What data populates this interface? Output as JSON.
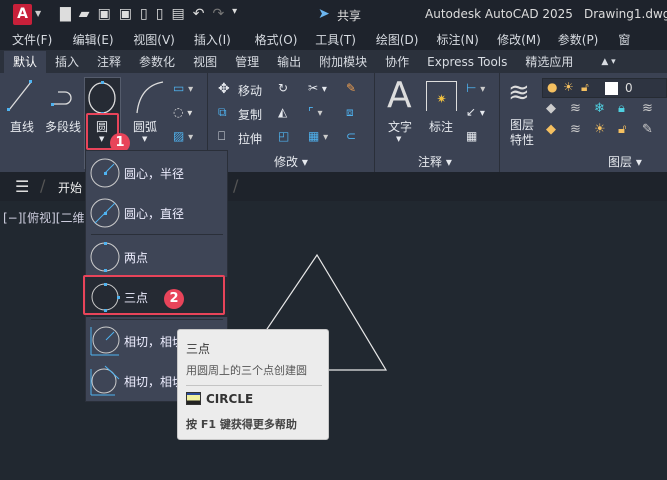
{
  "title_bar": {
    "app_title": "Autodesk AutoCAD 2025",
    "doc_title": "Drawing1.dwg",
    "share_label": "共享",
    "logo_letter": "A"
  },
  "menu": [
    "文件(F)",
    "编辑(E)",
    "视图(V)",
    "插入(I)",
    "格式(O)",
    "工具(T)",
    "绘图(D)",
    "标注(N)",
    "修改(M)",
    "参数(P)",
    "窗"
  ],
  "ribbon_tabs": [
    "默认",
    "插入",
    "注释",
    "参数化",
    "视图",
    "管理",
    "输出",
    "附加模块",
    "协作",
    "Express Tools",
    "精选应用"
  ],
  "ribbon": {
    "draw": {
      "line": "直线",
      "polyline": "多段线",
      "circle": "圆",
      "arc": "圆弧"
    },
    "modify": {
      "move": "移动",
      "copy": "复制",
      "stretch": "拉伸",
      "panel": "修改"
    },
    "annotation": {
      "text": "文字",
      "dimension": "标注",
      "panel": "注释"
    },
    "layers": {
      "properties_line1": "图层",
      "properties_line2": "特性",
      "current_layer": "0",
      "panel": "图层"
    }
  },
  "file_tabs": {
    "start": "开始"
  },
  "viewport_label": "[−][俯视][二维",
  "circle_menu": [
    "圆心，半径",
    "圆心，直径",
    "两点",
    "三点",
    "相切，相切",
    "相切，相切"
  ],
  "tooltip": {
    "title": "三点",
    "description": "用圆周上的三个点创建圆",
    "command": "CIRCLE",
    "help": "按 F1 键获得更多帮助"
  },
  "badges": [
    "1",
    "2"
  ],
  "colors": {
    "accent": "#e8445a",
    "ribbon_bg": "#3b4253",
    "canvas_bg": "#212830",
    "icon_blue": "#4fb3f0"
  }
}
